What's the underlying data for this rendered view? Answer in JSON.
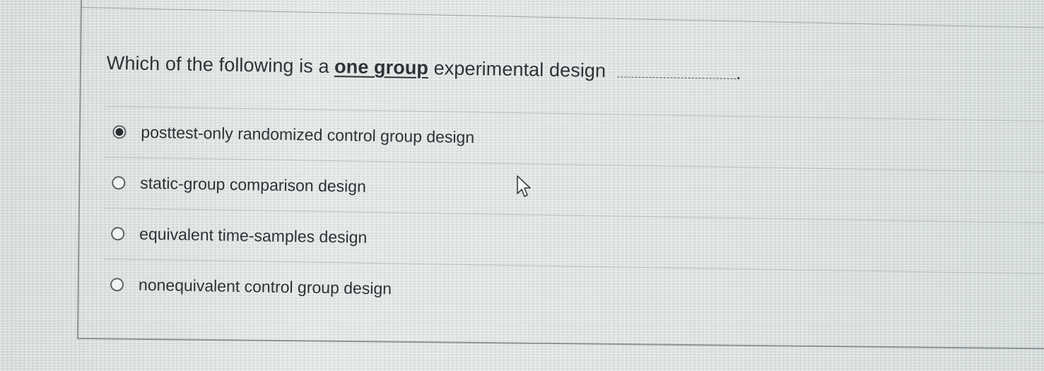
{
  "question": {
    "prefix": "Which of the following is a ",
    "emphasis": "one group",
    "suffix": " experimental design",
    "end_punct": "."
  },
  "options": [
    {
      "label": "posttest-only randomized control group design",
      "selected": true
    },
    {
      "label": "static-group comparison design",
      "selected": false
    },
    {
      "label": "equivalent time-samples design",
      "selected": false
    },
    {
      "label": "nonequivalent control group design",
      "selected": false
    }
  ],
  "icons": {
    "cursor": "mouse-pointer-icon",
    "radio_checked": "radio-checked-icon",
    "radio_unchecked": "radio-unchecked-icon"
  },
  "colors": {
    "text": "#2f3236",
    "border": "#8d9394",
    "background": "#dbe1df"
  }
}
